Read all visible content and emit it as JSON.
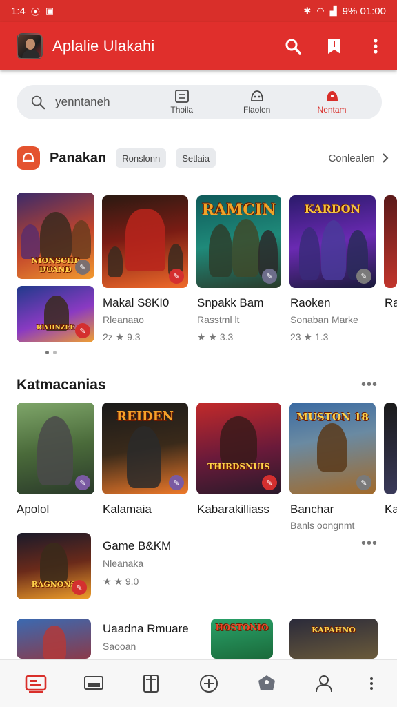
{
  "status_bar": {
    "left": "1:4",
    "right": "9% 01:00"
  },
  "app_bar": {
    "title": "Aplalie Ulakahi"
  },
  "search": {
    "text": "yenntaneh"
  },
  "segments": [
    {
      "label": "Thoila"
    },
    {
      "label": "Flaolen"
    },
    {
      "label": "Nentam"
    }
  ],
  "section1": {
    "title": "Panakan",
    "chips": [
      "Ronslonn",
      "Setlaia"
    ],
    "more": "Conlealen",
    "cards": [
      {
        "art": "NIONSCHE DUAND"
      },
      {
        "art": ""
      },
      {
        "art": "RAMCIN"
      },
      {
        "art": "KARDON"
      },
      {
        "art": "RIYHNZEE"
      }
    ],
    "items": [
      {
        "name": "Makal S8KI0",
        "sub": "Rleanaao",
        "rating": "2z ★ 9.3"
      },
      {
        "name": "Snpakk Bam",
        "sub": "Rasstml lt",
        "rating": "★ ★ 3.3"
      },
      {
        "name": "Raoken",
        "sub": "Sonaban Marke",
        "rating": "23 ★ 1.3"
      },
      {
        "name": "Ra",
        "sub": "",
        "rating": ""
      }
    ]
  },
  "section2": {
    "title": "Katmacanias",
    "cards": [
      {
        "art": ""
      },
      {
        "art": "REIDEN"
      },
      {
        "art": "THIRDSNUIS"
      },
      {
        "art": "MUSTON 18"
      }
    ],
    "items": [
      {
        "name": "Apolol",
        "sub": ""
      },
      {
        "name": "Kalamaia",
        "sub": ""
      },
      {
        "name": "Kabarakilliass",
        "sub": ""
      },
      {
        "name": "Banchar",
        "sub": "Banls oongnmt"
      },
      {
        "name": "Ka",
        "sub": ""
      }
    ]
  },
  "list": [
    {
      "name": "Game B&KM",
      "sub": "Nleanaka",
      "rating": "★ ★ 9.0",
      "art": "RAGNONS"
    },
    {
      "name": "Uaadna Rmuare",
      "sub": "Saooan",
      "rating": "",
      "art": ""
    }
  ],
  "extra_cards": [
    {
      "art": "HOSTONIO"
    },
    {
      "art": "KAPAHNO"
    }
  ],
  "colors": {
    "primary": "#e02f2c",
    "active": "#d92f2a"
  }
}
